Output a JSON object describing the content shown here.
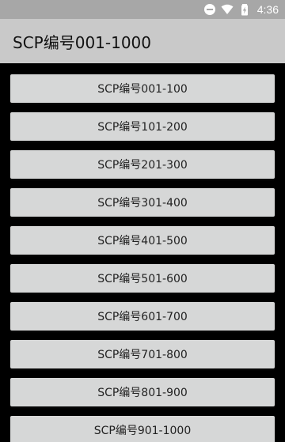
{
  "status_bar": {
    "time": "4:36",
    "icons": [
      "do-not-disturb-icon",
      "wifi-icon",
      "battery-charging-icon"
    ]
  },
  "app_bar": {
    "title": "SCP编号001-1000"
  },
  "list": {
    "items": [
      {
        "label": "SCP编号001-100"
      },
      {
        "label": "SCP编号101-200"
      },
      {
        "label": "SCP编号201-300"
      },
      {
        "label": "SCP编号301-400"
      },
      {
        "label": "SCP编号401-500"
      },
      {
        "label": "SCP编号501-600"
      },
      {
        "label": "SCP编号601-700"
      },
      {
        "label": "SCP编号701-800"
      },
      {
        "label": "SCP编号801-900"
      },
      {
        "label": "SCP编号901-1000"
      }
    ]
  },
  "colors": {
    "status_bar": "#a7a7a7",
    "app_bar": "#c9c9c9",
    "list_background": "#000000",
    "button": "#d6d7d7"
  }
}
